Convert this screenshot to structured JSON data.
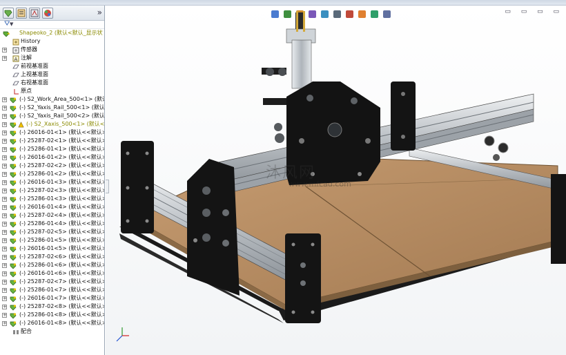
{
  "tree": {
    "root_label": "Shapeoko_2  (默认<默认_显示状",
    "items": [
      {
        "label": "History"
      },
      {
        "label": "传感器"
      },
      {
        "label": "注解"
      },
      {
        "label": "前视基准面"
      },
      {
        "label": "上视基准面"
      },
      {
        "label": "右视基准面"
      },
      {
        "label": "原点"
      },
      {
        "label": "(-) S2_Work_Area_500<1> (默认"
      },
      {
        "label": "(-) S2_Yaxis_Rail_500<1> (默认"
      },
      {
        "label": "(-) S2_Yaxis_Rail_500<2> (默认"
      },
      {
        "label": "(-) S2_Xaxis_500<1> (默认<默"
      },
      {
        "label": "(-) 26016-01<1> (默认<<默认>"
      },
      {
        "label": "(-) 25287-02<1> (默认<<默认>"
      },
      {
        "label": "(-) 25286-01<1> (默认<<默认>"
      },
      {
        "label": "(-) 26016-01<2> (默认<<默认>"
      },
      {
        "label": "(-) 25287-02<2> (默认<<默认>"
      },
      {
        "label": "(-) 25286-01<2> (默认<<默认>"
      },
      {
        "label": "(-) 26016-01<3> (默认<<默认>"
      },
      {
        "label": "(-) 25287-02<3> (默认<<默认>"
      },
      {
        "label": "(-) 25286-01<3> (默认<<默认>"
      },
      {
        "label": "(-) 26016-01<4> (默认<<默认>"
      },
      {
        "label": "(-) 25287-02<4> (默认<<默认>"
      },
      {
        "label": "(-) 25286-01<4> (默认<<默认>"
      },
      {
        "label": "(-) 25287-02<5> (默认<<默认>"
      },
      {
        "label": "(-) 25286-01<5> (默认<<默认>"
      },
      {
        "label": "(-) 26016-01<5> (默认<<默认>"
      },
      {
        "label": "(-) 25287-02<6> (默认<<默认>"
      },
      {
        "label": "(-) 25286-01<6> (默认<<默认>"
      },
      {
        "label": "(-) 26016-01<6> (默认<<默认>"
      },
      {
        "label": "(-) 25287-02<7> (默认<<默认>"
      },
      {
        "label": "(-) 25286-01<7> (默认<<默认>"
      },
      {
        "label": "(-) 26016-01<7> (默认<<默认>"
      },
      {
        "label": "(-) 25287-02<8> (默认<<默认>"
      },
      {
        "label": "(-) 25286-01<8> (默认<<默认>"
      },
      {
        "label": "(-) 26016-01<8> (默认<<默认>"
      },
      {
        "label": "配合"
      }
    ]
  },
  "panel": {
    "expand_glyph": "»",
    "filter_glyph": "▼"
  },
  "viewport": {
    "watermark": "沐风网",
    "watermark_url": "www.mfcad.com",
    "headsup_icons": [
      "zoom-fit-icon",
      "zoom-area-icon",
      "previous-view-icon",
      "section-view-icon",
      "view-orientation-icon",
      "display-style-icon",
      "hide-show-icon",
      "appearance-icon",
      "scene-icon",
      "display-manager-icon"
    ],
    "window_controls": "▭ ▭ ▭ ▭"
  },
  "colors": {
    "board": "#b58d64",
    "plate": "#151515",
    "rail": "#c7ccd0",
    "tree_warn": "#8a8a00"
  }
}
